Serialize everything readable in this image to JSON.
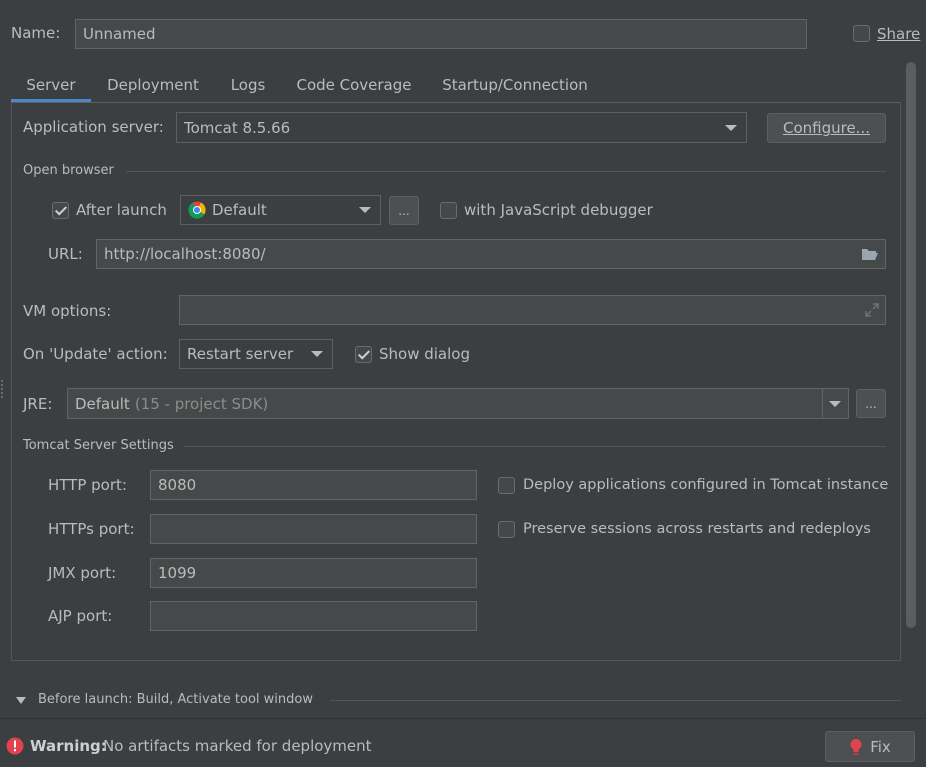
{
  "name_row": {
    "label": "Name:",
    "value": "Unnamed",
    "share_label": "Share",
    "share_checked": false
  },
  "tabs": [
    {
      "label": "Server",
      "active": true
    },
    {
      "label": "Deployment",
      "active": false
    },
    {
      "label": "Logs",
      "active": false
    },
    {
      "label": "Code Coverage",
      "active": false
    },
    {
      "label": "Startup/Connection",
      "active": false
    }
  ],
  "server": {
    "app_server_label": "Application server:",
    "app_server_value": "Tomcat 8.5.66",
    "configure_label": "Configure...",
    "open_browser": {
      "section_label": "Open browser",
      "after_launch_label": "After launch",
      "after_launch_checked": true,
      "browser_value": "Default",
      "browse_label": "...",
      "js_debugger_label": "with JavaScript debugger",
      "js_debugger_checked": false,
      "url_label": "URL:",
      "url_value": "http://localhost:8080/"
    },
    "vm_options_label": "VM options:",
    "vm_options_value": "",
    "on_update_label": "On 'Update' action:",
    "on_update_value": "Restart server",
    "show_dialog_label": "Show dialog",
    "show_dialog_checked": true,
    "jre_label": "JRE:",
    "jre_value": "Default",
    "jre_hint": "(15 - project SDK)",
    "jre_browse_label": "...",
    "tomcat_settings": {
      "section_label": "Tomcat Server Settings",
      "http_port_label": "HTTP port:",
      "http_port_value": "8080",
      "https_port_label": "HTTPs port:",
      "https_port_value": "",
      "jmx_port_label": "JMX port:",
      "jmx_port_value": "1099",
      "ajp_port_label": "AJP port:",
      "ajp_port_value": "",
      "deploy_label": "Deploy applications configured in Tomcat instance",
      "deploy_checked": false,
      "preserve_label": "Preserve sessions across restarts and redeploys",
      "preserve_checked": false
    }
  },
  "before_launch": {
    "label": "Before launch: Build, Activate tool window"
  },
  "footer": {
    "warning_title": "Warning:",
    "warning_text": "No artifacts marked for deployment",
    "fix_label": "Fix"
  },
  "colors": {
    "background": "#3c3f41",
    "field": "#45494a",
    "accent": "#4a88c7",
    "error": "#e0424e",
    "text": "#bbbbbb"
  }
}
